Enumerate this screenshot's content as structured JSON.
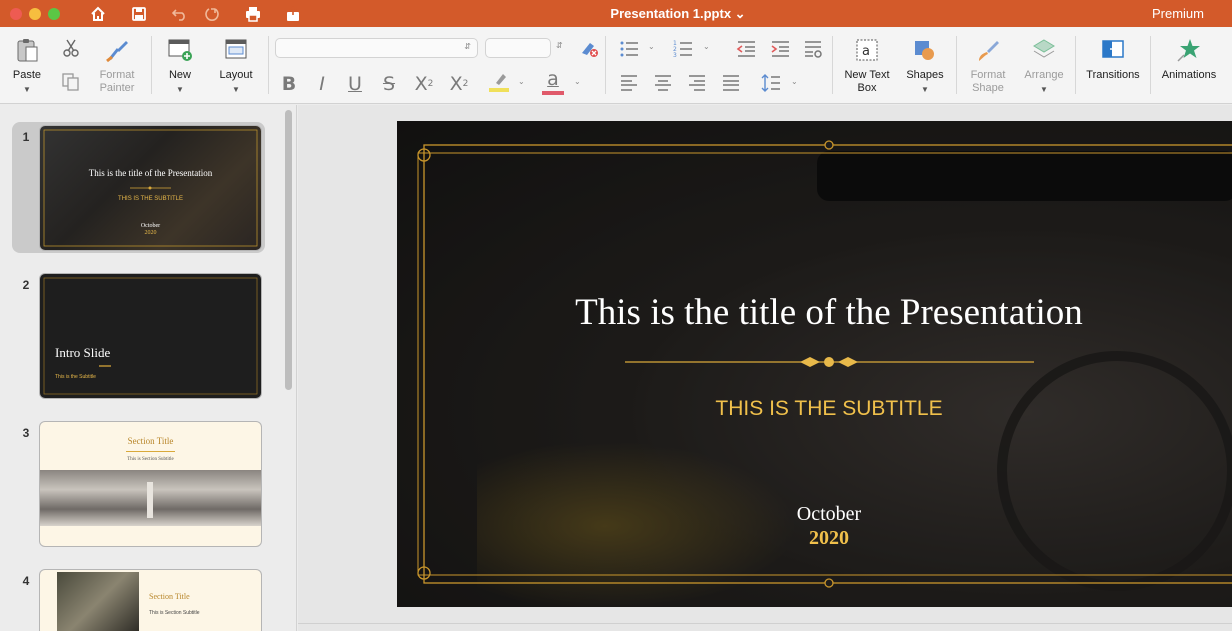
{
  "window": {
    "title": "Presentation 1.pptx",
    "premium": "Premium"
  },
  "ribbon": {
    "paste": "Paste",
    "format_painter": [
      "Format",
      "Painter"
    ],
    "new": "New",
    "layout": "Layout",
    "new_text_box": [
      "New Text",
      "Box"
    ],
    "shapes": "Shapes",
    "format_shape": [
      "Format",
      "Shape"
    ],
    "arrange": "Arrange",
    "transitions": "Transitions",
    "animations": "Animations",
    "font_buttons": {
      "bold": "B",
      "italic": "I",
      "underline": "U",
      "strike": "S",
      "superscript": "X",
      "subscript": "X",
      "sup_mark": "2",
      "sub_mark": "2",
      "font_color": "a"
    }
  },
  "slides": [
    {
      "num": "1",
      "title": "This is the title of the Presentation",
      "subtitle": "THIS IS THE SUBTITLE",
      "month": "October",
      "year": "2020"
    },
    {
      "num": "2",
      "title": "Intro Slide",
      "subtitle": "This is the Subtitle"
    },
    {
      "num": "3",
      "title": "Section Title",
      "subtitle": "This is Section Subtitle"
    },
    {
      "num": "4",
      "title": "Section Title",
      "subtitle": "This is Section Subtitle"
    }
  ],
  "colors": {
    "accent": "#d35a2a",
    "gold": "#f0c04b",
    "slide_bg": "#1f1f1f"
  },
  "icons": [
    "home-icon",
    "save-icon",
    "undo-icon",
    "redo-icon",
    "print-icon",
    "share-icon"
  ]
}
